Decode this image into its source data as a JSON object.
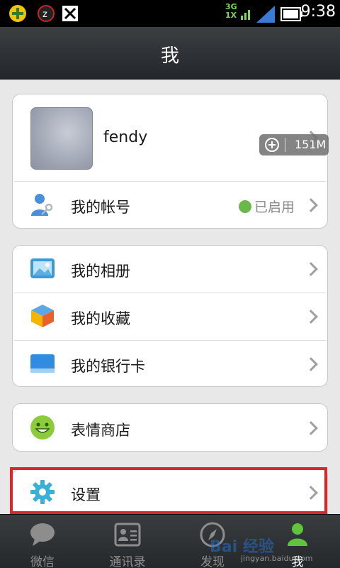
{
  "status_bar": {
    "time": "9:38",
    "network": "3G\n1X"
  },
  "header": {
    "title": "我"
  },
  "profile": {
    "name": "fendy",
    "memory_overlay": "151M"
  },
  "account_row": {
    "label": "我的帐号",
    "status": "已启用"
  },
  "menu_group_1": [
    {
      "label": "我的相册",
      "icon": "album-icon"
    },
    {
      "label": "我的收藏",
      "icon": "favorites-icon"
    },
    {
      "label": "我的银行卡",
      "icon": "bank-card-icon"
    }
  ],
  "menu_group_2": [
    {
      "label": "表情商店",
      "icon": "sticker-store-icon"
    }
  ],
  "menu_group_3": [
    {
      "label": "设置",
      "icon": "settings-icon"
    }
  ],
  "tabs": [
    {
      "label": "微信",
      "icon": "chat-bubble-icon",
      "active": false
    },
    {
      "label": "通讯录",
      "icon": "contacts-icon",
      "active": false
    },
    {
      "label": "发现",
      "icon": "compass-icon",
      "active": false
    },
    {
      "label": "我",
      "icon": "me-icon",
      "active": true
    }
  ],
  "watermark": {
    "brand": "Bai 经验",
    "url": "jingyan.baidu.com"
  }
}
